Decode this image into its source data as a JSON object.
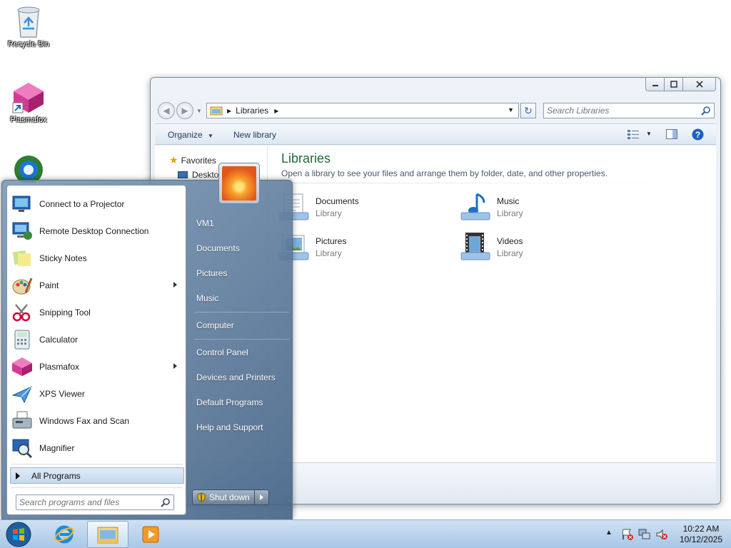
{
  "desktop": {
    "icons": [
      {
        "label": "Recycle Bin"
      },
      {
        "label": "Plasmafox"
      }
    ]
  },
  "explorer": {
    "address_crumb": "Libraries",
    "search_placeholder": "Search Libraries",
    "toolbar": {
      "organize": "Organize",
      "new_library": "New library"
    },
    "nav": {
      "favorites": "Favorites",
      "desktop": "Desktop"
    },
    "heading": "Libraries",
    "subheading": "Open a library to see your files and arrange them by folder, date, and other properties.",
    "libraries": [
      {
        "name": "Documents",
        "type": "Library"
      },
      {
        "name": "Music",
        "type": "Library"
      },
      {
        "name": "Pictures",
        "type": "Library"
      },
      {
        "name": "Videos",
        "type": "Library"
      }
    ]
  },
  "start_menu": {
    "programs": [
      {
        "label": "Connect to a Projector",
        "icon": "projector-icon"
      },
      {
        "label": "Remote Desktop Connection",
        "icon": "remote-desktop-icon"
      },
      {
        "label": "Sticky Notes",
        "icon": "sticky-notes-icon"
      },
      {
        "label": "Paint",
        "icon": "paint-icon"
      },
      {
        "label": "Snipping Tool",
        "icon": "scissors-icon"
      },
      {
        "label": "Calculator",
        "icon": "calculator-icon"
      },
      {
        "label": "Plasmafox",
        "icon": "plasmafox-icon"
      },
      {
        "label": "XPS Viewer",
        "icon": "xps-viewer-icon"
      },
      {
        "label": "Windows Fax and Scan",
        "icon": "fax-icon"
      },
      {
        "label": "Magnifier",
        "icon": "magnifier-icon"
      }
    ],
    "all_programs": "All Programs",
    "search_placeholder": "Search programs and files",
    "right_links": {
      "user": "VM1",
      "documents": "Documents",
      "pictures": "Pictures",
      "music": "Music",
      "computer": "Computer",
      "control_panel": "Control Panel",
      "devices_printers": "Devices and Printers",
      "default_programs": "Default Programs",
      "help_support": "Help and Support"
    },
    "shutdown": "Shut down"
  },
  "taskbar": {
    "clock_time": "10:22 AM",
    "clock_date": "10/12/2025"
  }
}
